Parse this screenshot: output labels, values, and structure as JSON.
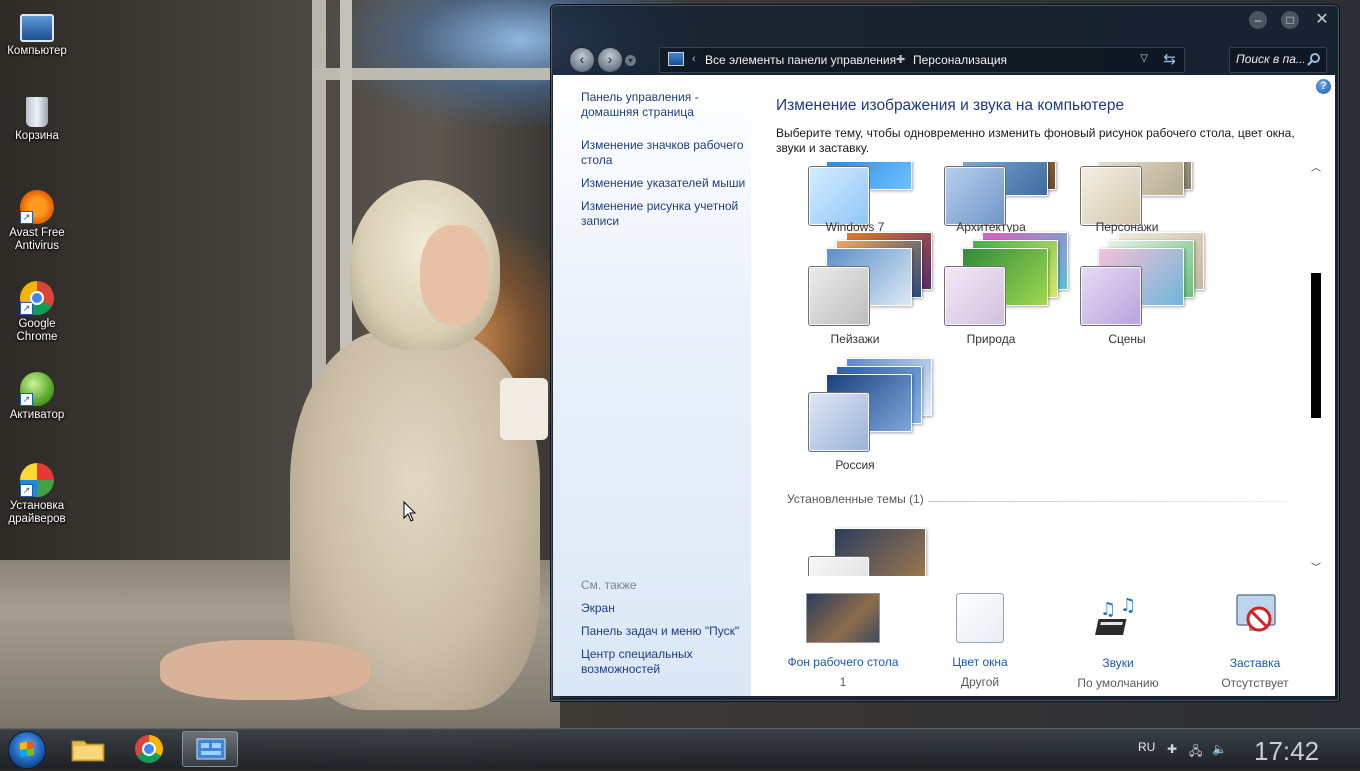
{
  "desktop": {
    "icons": [
      {
        "label": "Компьютер"
      },
      {
        "label": "Корзина"
      },
      {
        "label": "Avast Free Antivirus"
      },
      {
        "label": "Google Chrome"
      },
      {
        "label": "Активатор"
      },
      {
        "label": "Установка драйверов"
      }
    ]
  },
  "window": {
    "address": {
      "crumb1": "Все элементы панели управления",
      "crumb2": "Персонализация"
    },
    "search": {
      "placeholder": "Поиск в па..."
    }
  },
  "leftpane": {
    "links": [
      "Панель управления - домашняя страница",
      "Изменение значков рабочего стола",
      "Изменение указателей мыши",
      "Изменение рисунка учетной записи"
    ],
    "see_also_title": "См. также",
    "see_also": [
      "Экран",
      "Панель задач и меню \"Пуск\"",
      "Центр специальных возможностей"
    ]
  },
  "main": {
    "title": "Изменение изображения и звука на компьютере",
    "description": "Выберите тему, чтобы одновременно изменить фоновый рисунок рабочего стола, цвет окна, звуки и заставку.",
    "themes": [
      {
        "name": "Windows 7"
      },
      {
        "name": "Архитектура"
      },
      {
        "name": "Персонажи"
      },
      {
        "name": "Пейзажи"
      },
      {
        "name": "Природа"
      },
      {
        "name": "Сцены"
      },
      {
        "name": "Россия"
      }
    ],
    "installed_group": "Установленные темы (1)"
  },
  "bottom": {
    "items": [
      {
        "label": "Фон рабочего стола",
        "value": "1"
      },
      {
        "label": "Цвет окна",
        "value": "Другой"
      },
      {
        "label": "Звуки",
        "value": "По умолчанию"
      },
      {
        "label": "Заставка",
        "value": "Отсутствует"
      }
    ]
  },
  "taskbar": {
    "language": "RU",
    "clock": "17:42"
  }
}
